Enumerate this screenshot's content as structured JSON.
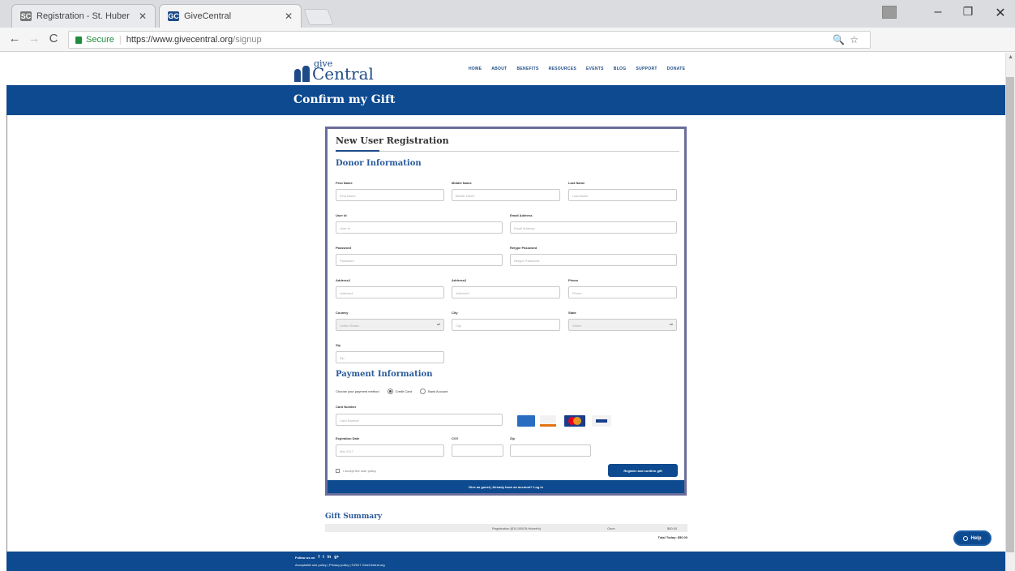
{
  "browser": {
    "tabs": [
      {
        "label": "Registration - St. Huber"
      },
      {
        "label": "GiveCentral"
      }
    ],
    "secure_label": "Secure",
    "url_host": "https://www.givecentral.org",
    "url_path": "/signup",
    "favicon_1": "SC",
    "favicon_2": "GC"
  },
  "site": {
    "logo_give": "give",
    "logo_central": "Central",
    "nav": [
      "HOME",
      "ABOUT",
      "BENEFITS",
      "RESOURCES",
      "EVENTS",
      "BLOG",
      "SUPPORT",
      "DONATE"
    ],
    "page_title": "Confirm my Gift"
  },
  "form": {
    "heading": "New User Registration",
    "donor_section": "Donor Information",
    "fields": {
      "first_name": {
        "label": "First Name",
        "placeholder": "First Name"
      },
      "middle_name": {
        "label": "Middle Name",
        "placeholder": "Middle Name"
      },
      "last_name": {
        "label": "Last Name",
        "placeholder": "Last Name"
      },
      "user_id": {
        "label": "User Id",
        "placeholder": "User Id"
      },
      "email": {
        "label": "Email Address",
        "placeholder": "Email Address"
      },
      "password": {
        "label": "Password",
        "placeholder": "Password"
      },
      "retype_password": {
        "label": "Retype Password",
        "placeholder": "Retype Password"
      },
      "address1": {
        "label": "Address1",
        "placeholder": "Address1"
      },
      "address2": {
        "label": "Address2",
        "placeholder": "Address2"
      },
      "phone": {
        "label": "Phone",
        "placeholder": "Phone"
      },
      "country": {
        "label": "Country",
        "value": "United States"
      },
      "city": {
        "label": "City",
        "placeholder": "City"
      },
      "state": {
        "label": "State",
        "value": "Select"
      },
      "zip": {
        "label": "Zip",
        "placeholder": "Zip"
      }
    },
    "payment_section": "Payment Information",
    "payment_method_label": "Choose your payment method",
    "payment_options": [
      "Credit Card",
      "Bank Account"
    ],
    "card_number": {
      "label": "Card Number",
      "placeholder": "Card Number"
    },
    "expiration": {
      "label": "Expiration Date",
      "value": "Mar 2017"
    },
    "cvv": {
      "label": "CVV"
    },
    "pay_zip": {
      "label": "Zip"
    },
    "terms_label": "I accept the user policy",
    "submit_label": "Register and confirm gift",
    "footer_text": "Give as guest | Already have an account? Log in"
  },
  "gift_summary": {
    "title": "Gift Summary",
    "row": {
      "description": "Registration ($10,000/St.Hubert's)",
      "frequency": "Once",
      "amount": "$50.00"
    },
    "total": "Total Today: $50.00"
  },
  "footer": {
    "follow_label": "Follow us on",
    "social_icons": [
      "f",
      "t",
      "in",
      "g+"
    ],
    "links": "Acceptable use policy | Privacy policy | ©2017 GiveCentral.org"
  },
  "help_button": "Help",
  "colors": {
    "brand_blue": "#0d4a8f",
    "card_border": "#6b6d9a"
  }
}
